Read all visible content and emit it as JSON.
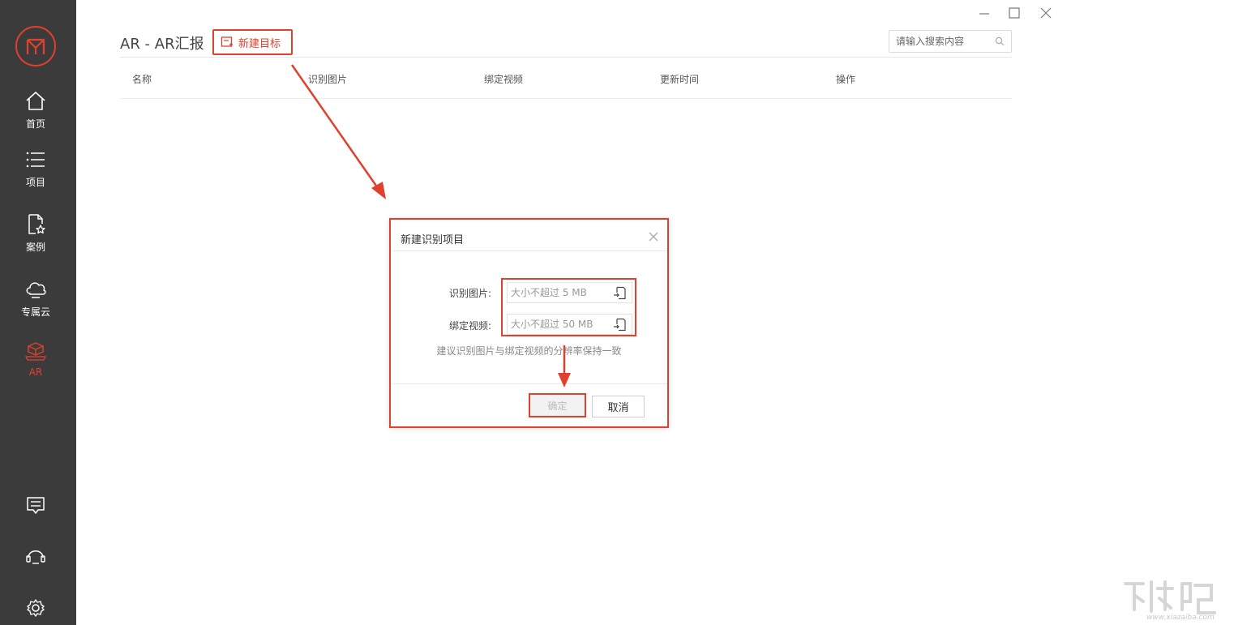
{
  "sidebar": {
    "items": [
      {
        "label": "首页",
        "icon": "home-icon"
      },
      {
        "label": "项目",
        "icon": "list-icon"
      },
      {
        "label": "案例",
        "icon": "file-star-icon"
      },
      {
        "label": "专属云",
        "icon": "cloud-icon"
      },
      {
        "label": "AR",
        "icon": "ar-box-icon",
        "active": true
      }
    ],
    "bottom_icons": [
      "message-icon",
      "headset-icon",
      "settings-icon"
    ],
    "colors": {
      "background": "#3b3b3b",
      "accent": "#e1402e"
    }
  },
  "window": {
    "controls": [
      "minimize-icon",
      "maximize-icon",
      "close-icon"
    ]
  },
  "header": {
    "title": "AR - AR汇报",
    "new_target_label": "新建目标",
    "search_placeholder": "请输入搜索内容"
  },
  "table": {
    "columns": [
      "名称",
      "识别图片",
      "绑定视频",
      "更新时间",
      "操作"
    ]
  },
  "dialog": {
    "title": "新建识别项目",
    "image_label": "识别图片:",
    "image_placeholder": "大小不超过 5 MB",
    "video_label": "绑定视频:",
    "video_placeholder": "大小不超过 50 MB",
    "hint": "建议识别图片与绑定视频的分辨率保持一致",
    "confirm_label": "确定",
    "cancel_label": "取消"
  },
  "watermark": {
    "site": "www.xiazaiba.com"
  }
}
